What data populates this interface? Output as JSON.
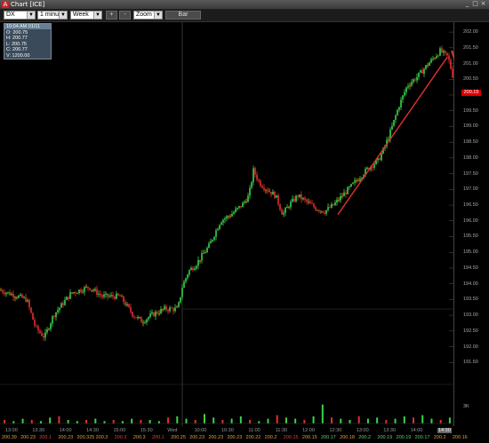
{
  "window": {
    "title": "Chart [ICE]"
  },
  "toolbar": {
    "symbol": "DX",
    "interval": "1 minute",
    "range": "Week",
    "plus": "+",
    "minus": "-",
    "zoom": "Zoom",
    "bar": "Bar"
  },
  "ohlc": {
    "header": "10:04 AM  01/11",
    "open": "O: 200.75",
    "high": "H: 200.77",
    "low": "L: 200.75",
    "close": "C: 200.77",
    "volume": "V: 1200.00"
  },
  "last_price": "200.15",
  "volume_label": "3K",
  "colors": {
    "up": "#3cd24a",
    "down": "#e03030",
    "mid": "#e0a020",
    "trendline": "#e03030",
    "arrow": "#c83c2c"
  },
  "chart_data": {
    "type": "candlestick",
    "ylim": [
      191.0,
      202.2
    ],
    "y_ticks": [
      "202.00",
      "201.50",
      "201.00",
      "200.50",
      "200.00",
      "199.50",
      "199.00",
      "198.50",
      "198.00",
      "197.50",
      "197.00",
      "196.50",
      "196.00",
      "195.50",
      "195.00",
      "194.50",
      "194.00",
      "193.50",
      "193.00",
      "192.50",
      "192.00",
      "191.50"
    ],
    "x_ticks": [
      "13:00",
      "13:30",
      "14:00",
      "14:30",
      "15:00",
      "15:30",
      "Wed",
      "10:00",
      "10:30",
      "11:00",
      "11:30",
      "12:00",
      "12:30",
      "13:00",
      "13:30",
      "14:00",
      "14:30"
    ],
    "highlighted_tick": "14:30",
    "trend": [
      [
        0,
        193.8
      ],
      [
        20,
        193.6
      ],
      [
        30,
        193.5
      ],
      [
        40,
        192.6
      ],
      [
        50,
        192.3
      ],
      [
        60,
        193.0
      ],
      [
        80,
        193.7
      ],
      [
        100,
        193.9
      ],
      [
        115,
        193.6
      ],
      [
        135,
        193.6
      ],
      [
        150,
        193.0
      ],
      [
        160,
        192.8
      ],
      [
        170,
        193.0
      ],
      [
        185,
        193.2
      ],
      [
        200,
        193.2
      ],
      [
        205,
        193.9
      ],
      [
        212,
        194.4
      ],
      [
        220,
        194.6
      ],
      [
        235,
        195.2
      ],
      [
        248,
        196.0
      ],
      [
        260,
        196.2
      ],
      [
        272,
        196.5
      ],
      [
        280,
        196.8
      ],
      [
        285,
        197.6
      ],
      [
        292,
        197.2
      ],
      [
        300,
        197.0
      ],
      [
        310,
        196.8
      ],
      [
        318,
        196.2
      ],
      [
        325,
        196.5
      ],
      [
        335,
        196.8
      ],
      [
        345,
        196.6
      ],
      [
        355,
        196.4
      ],
      [
        365,
        196.3
      ],
      [
        375,
        196.5
      ],
      [
        385,
        196.8
      ],
      [
        395,
        197.1
      ],
      [
        405,
        197.4
      ],
      [
        415,
        197.7
      ],
      [
        425,
        197.9
      ],
      [
        432,
        198.3
      ],
      [
        440,
        198.9
      ],
      [
        448,
        199.6
      ],
      [
        458,
        200.3
      ],
      [
        470,
        200.6
      ],
      [
        482,
        201.0
      ],
      [
        495,
        201.4
      ],
      [
        504,
        201.2
      ],
      [
        511,
        200.4
      ]
    ],
    "volumes_k": [
      0.3,
      0.2,
      0.4,
      0.3,
      0.2,
      0.5,
      0.6,
      0.3,
      0.2,
      0.3,
      0.4,
      0.2,
      0.3,
      0.2,
      0.4,
      0.3,
      0.3,
      0.2,
      0.5,
      0.6,
      0.4,
      0.3,
      0.8,
      0.5,
      0.3,
      0.4,
      0.6,
      0.3,
      0.2,
      0.4,
      0.7,
      0.5,
      0.4,
      0.3,
      0.6,
      1.6,
      0.5,
      0.4,
      0.3,
      0.6,
      0.4,
      0.5,
      0.3,
      0.4,
      0.6,
      0.5,
      0.7,
      0.4,
      0.3,
      0.5
    ],
    "volume_max_k": 3,
    "annotations": [
      "trendline",
      "down-arrow"
    ]
  },
  "bottom_values": [
    {
      "v": "200.39",
      "c": "mid"
    },
    {
      "v": "200.23",
      "c": "mid"
    },
    {
      "v": "200.1",
      "c": "r"
    },
    {
      "v": "200.23",
      "c": "mid"
    },
    {
      "v": "200.325",
      "c": "mid"
    },
    {
      "v": "200.3",
      "c": "mid"
    },
    {
      "v": "200.3",
      "c": "r"
    },
    {
      "v": "200.3",
      "c": "mid"
    },
    {
      "v": "200.1",
      "c": "r"
    },
    {
      "v": "200.25",
      "c": "mid"
    },
    {
      "v": "200.23",
      "c": "mid"
    },
    {
      "v": "200.23",
      "c": "mid"
    },
    {
      "v": "200.23",
      "c": "mid"
    },
    {
      "v": "200.22",
      "c": "mid"
    },
    {
      "v": "200.2",
      "c": "mid"
    },
    {
      "v": "200.15",
      "c": "r"
    },
    {
      "v": "200.15",
      "c": "mid"
    },
    {
      "v": "200.17",
      "c": "g"
    },
    {
      "v": "200.18",
      "c": "mid"
    },
    {
      "v": "200.2",
      "c": "g"
    },
    {
      "v": "200.19",
      "c": "g"
    },
    {
      "v": "200.19",
      "c": "g"
    },
    {
      "v": "200.17",
      "c": "g"
    },
    {
      "v": "200.2",
      "c": "mid"
    },
    {
      "v": "200.16",
      "c": "mid"
    }
  ]
}
